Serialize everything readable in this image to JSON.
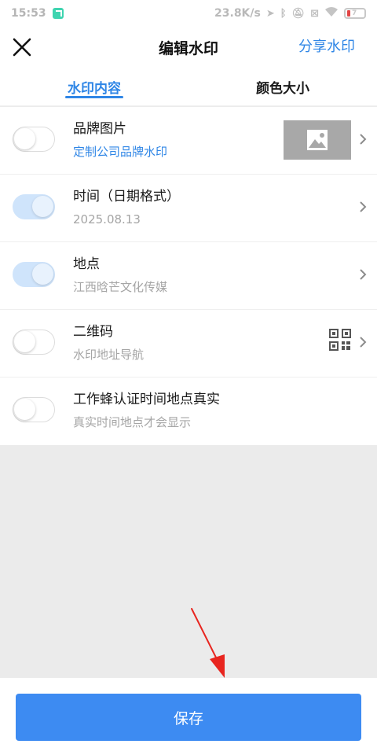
{
  "status_bar": {
    "time": "15:53",
    "net_speed": "23.8K/s",
    "battery_level": "7"
  },
  "nav": {
    "title": "编辑水印",
    "share_label": "分享水印"
  },
  "tabs": [
    {
      "label": "水印内容",
      "active": true
    },
    {
      "label": "颜色大小",
      "active": false
    }
  ],
  "items": [
    {
      "title": "品牌图片",
      "subtitle": "定制公司品牌水印",
      "enabled": false
    },
    {
      "title": "时间（日期格式）",
      "subtitle": "2025.08.13",
      "enabled": true
    },
    {
      "title": "地点",
      "subtitle": "江西晗芒文化传媒",
      "enabled": true
    },
    {
      "title": "二维码",
      "subtitle": "水印地址导航",
      "enabled": false
    },
    {
      "title": "工作蜂认证时间地点真实",
      "subtitle": "真实时间地点才会显示",
      "enabled": false
    }
  ],
  "save_label": "保存",
  "colors": {
    "accent": "#2f86e6",
    "save_button": "#3d8bf2",
    "annotation_arrow": "#e8251f"
  }
}
